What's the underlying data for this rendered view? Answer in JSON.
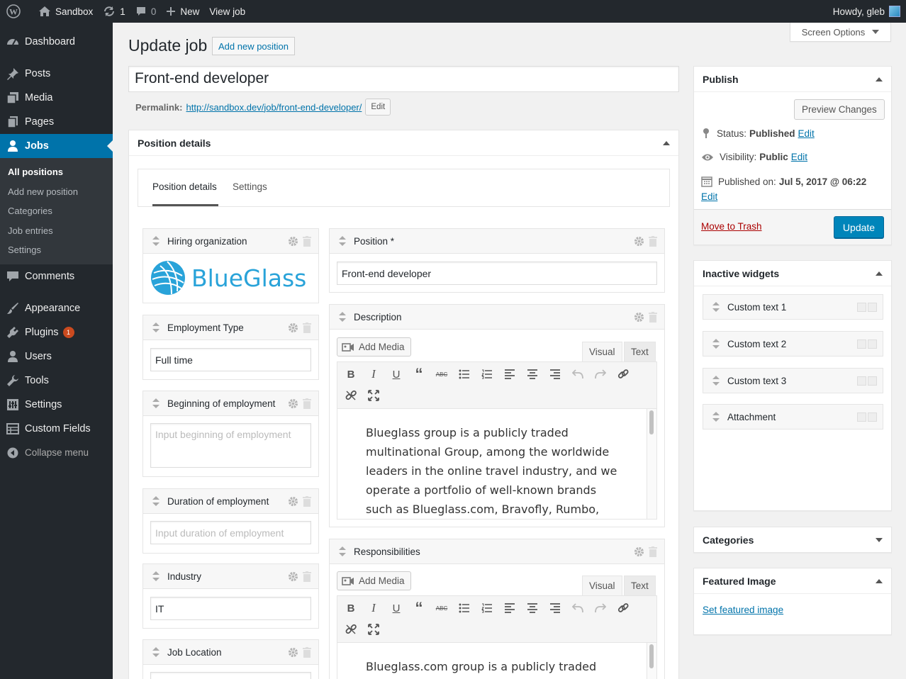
{
  "adminbar": {
    "site_name": "Sandbox",
    "updates_count": "1",
    "comments_count": "0",
    "new_label": "New",
    "view_label": "View job",
    "howdy": "Howdy, gleb"
  },
  "menu": {
    "dashboard": "Dashboard",
    "posts": "Posts",
    "media": "Media",
    "pages": "Pages",
    "jobs": "Jobs",
    "jobs_sub": [
      "All positions",
      "Add new position",
      "Categories",
      "Job entries",
      "Settings"
    ],
    "comments": "Comments",
    "appearance": "Appearance",
    "plugins": "Plugins",
    "plugins_badge": "1",
    "users": "Users",
    "tools": "Tools",
    "settings": "Settings",
    "custom_fields": "Custom Fields",
    "collapse": "Collapse menu"
  },
  "page": {
    "title": "Update job",
    "add_new": "Add new position",
    "screen_options": "Screen Options",
    "post_title": "Front-end developer",
    "permalink_label": "Permalink:",
    "permalink_url": "http://sandbox.dev/job/front-end-developer/",
    "permalink_edit": "Edit"
  },
  "position_box": {
    "title": "Position details",
    "tabs": [
      "Position details",
      "Settings"
    ],
    "left_widgets": {
      "hiring_org": "Hiring organization",
      "logo_text": "BlueGlass",
      "employment_type": "Employment Type",
      "employment_type_value": "Full time",
      "beginning": "Beginning of employment",
      "beginning_placeholder": "Input beginning of employment",
      "duration": "Duration of employment",
      "duration_placeholder": "Input duration of employment",
      "industry": "Industry",
      "industry_value": "IT",
      "location": "Job Location"
    },
    "right_widgets": {
      "position": "Position *",
      "position_value": "Front-end developer",
      "description": "Description",
      "description_text": "Blueglass group is a publicly traded multinational Group, among the worldwide leaders in the online travel industry, and we operate a portfolio of well-known brands such as Blueglass.com, Bravofly, Rumbo, Volagratis",
      "responsibilities": "Responsibilities",
      "responsibilities_text": "Blueglass.com group is a publicly traded",
      "add_media": "Add Media",
      "visual": "Visual",
      "text": "Text"
    }
  },
  "publish": {
    "title": "Publish",
    "preview": "Preview Changes",
    "status_label": "Status:",
    "status_value": "Published",
    "visibility_label": "Visibility:",
    "visibility_value": "Public",
    "published_label": "Published on:",
    "published_value": "Jul 5, 2017 @ 06:22",
    "edit": "Edit",
    "trash": "Move to Trash",
    "update": "Update"
  },
  "inactive": {
    "title": "Inactive widgets",
    "items": [
      "Custom text 1",
      "Custom text 2",
      "Custom text 3",
      "Attachment"
    ]
  },
  "categories": {
    "title": "Categories"
  },
  "featured": {
    "title": "Featured Image",
    "link": "Set featured image"
  },
  "colors": {
    "primary": "#0085ba",
    "menu_bg": "#23282d",
    "menu_current": "#0073aa",
    "link": "#0073aa",
    "logo": "#29a3d9"
  }
}
